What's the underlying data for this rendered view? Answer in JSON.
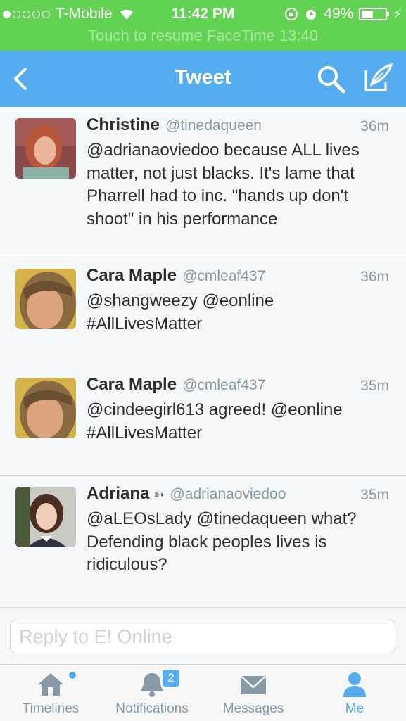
{
  "status_bar": {
    "carrier": "T-Mobile",
    "time": "11:42 PM",
    "battery": "49%",
    "banner": "Touch to resume FaceTime 13:40"
  },
  "nav": {
    "title": "Tweet",
    "back_icon": "chevron-left-icon",
    "search_icon": "search-icon",
    "compose_icon": "compose-icon"
  },
  "tweets": [
    {
      "name": "Christine",
      "handle": "@tinedaqueen",
      "time": "36m",
      "text": "@adrianaoviedoo because ALL lives matter, not just blacks. It's lame that Pharrell had to inc. \"hands up don't shoot\" in his performance"
    },
    {
      "name": "Cara Maple",
      "handle": "@cmleaf437",
      "time": "36m",
      "text": "@shangweezy @eonline #AllLivesMatter"
    },
    {
      "name": "Cara Maple",
      "handle": "@cmleaf437",
      "time": "35m",
      "text": "@cindeegirl613 agreed! @eonline #AllLivesMatter"
    },
    {
      "name": "Adriana",
      "arrow": "➳",
      "handle": "@adrianaoviedoo",
      "time": "35m",
      "text": "@aLEOsLady @tinedaqueen what? Defending black peoples lives is ridiculous?"
    }
  ],
  "reply": {
    "placeholder": "Reply to E! Online"
  },
  "tabs": [
    {
      "label": "Timelines",
      "icon": "home-icon"
    },
    {
      "label": "Notifications",
      "icon": "bell-icon",
      "badge": "2"
    },
    {
      "label": "Messages",
      "icon": "envelope-icon"
    },
    {
      "label": "Me",
      "icon": "person-icon"
    }
  ],
  "colors": {
    "status_green": "#62d252",
    "twitter_blue": "#55acee",
    "text_dark": "#292f33",
    "text_gray": "#8899a6"
  }
}
